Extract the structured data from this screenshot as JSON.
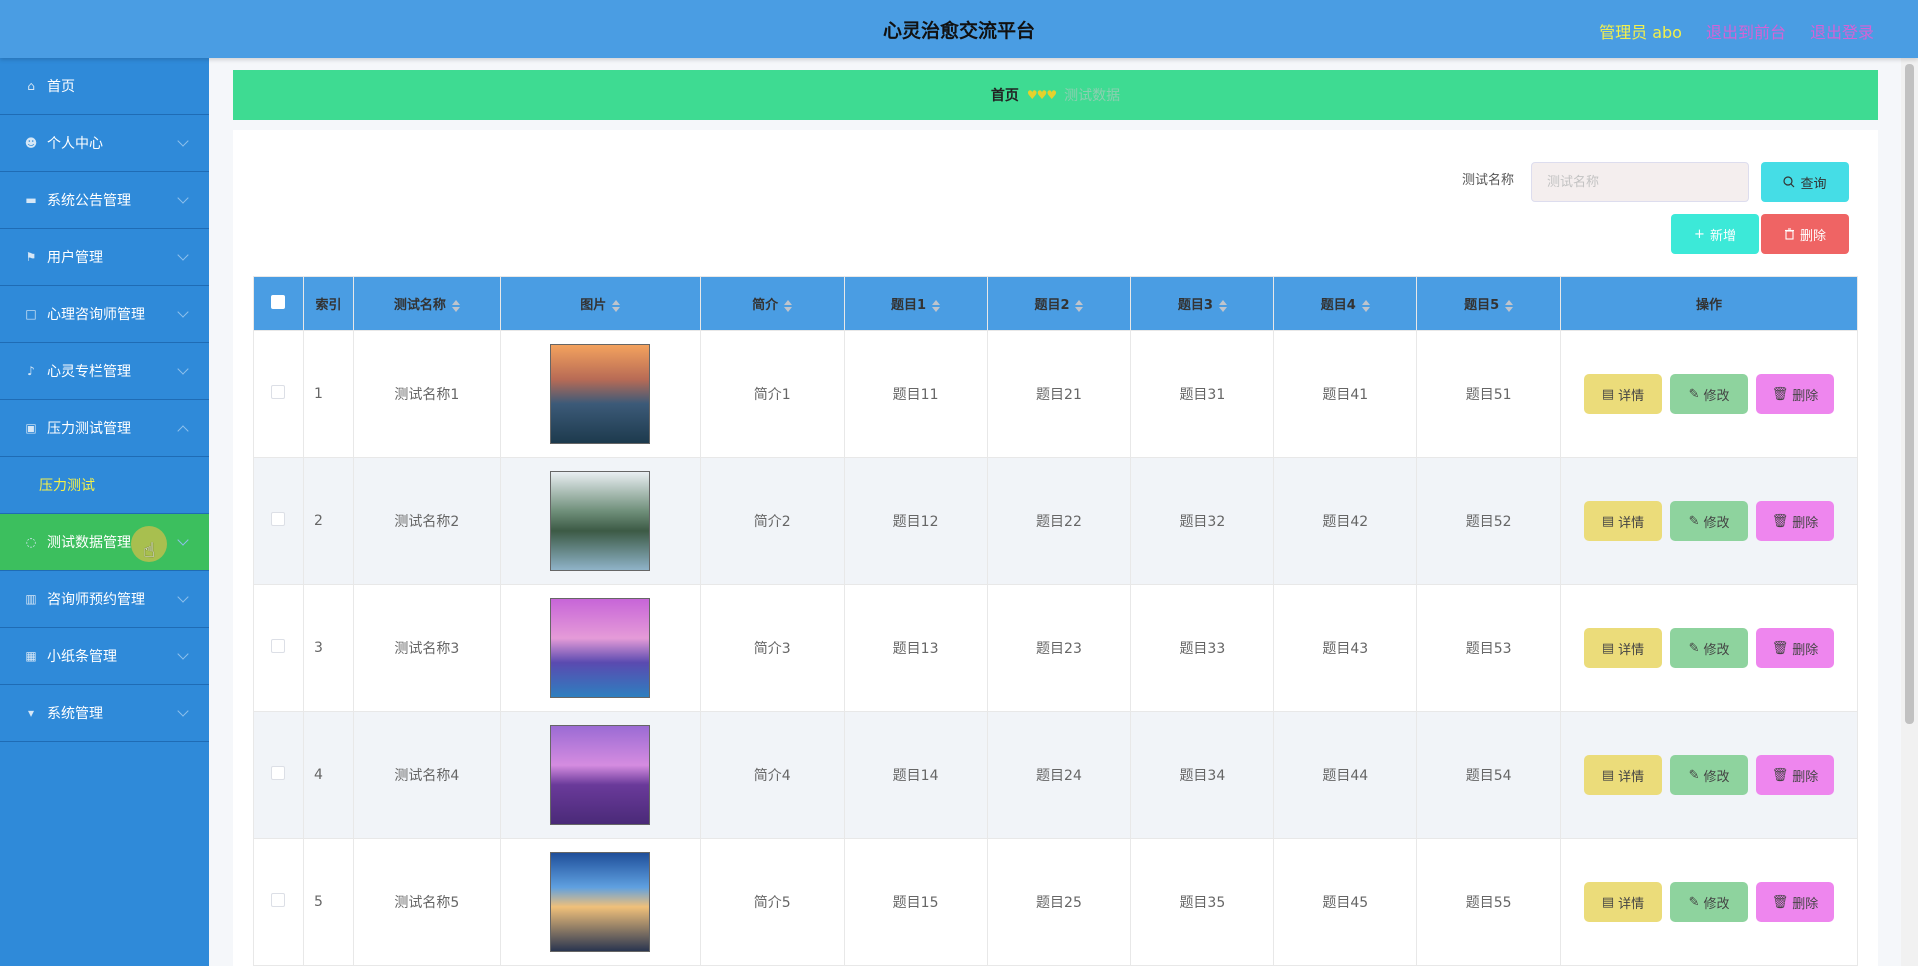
{
  "header": {
    "title": "心灵治愈交流平台",
    "admin_label": "管理员 abo",
    "front_link": "退出到前台",
    "logout_link": "退出登录"
  },
  "sidebar": {
    "items": [
      {
        "label": "首页",
        "icon": "home-icon",
        "glyph": "⌂",
        "expandable": false
      },
      {
        "label": "个人中心",
        "icon": "user-icon",
        "glyph": "☻",
        "expandable": true
      },
      {
        "label": "系统公告管理",
        "icon": "ticket-icon",
        "glyph": "▬",
        "expandable": true
      },
      {
        "label": "用户管理",
        "icon": "flag-icon",
        "glyph": "⚑",
        "expandable": true
      },
      {
        "label": "心理咨询师管理",
        "icon": "square-icon",
        "glyph": "□",
        "expandable": true
      },
      {
        "label": "心灵专栏管理",
        "icon": "microphone-icon",
        "glyph": "♪",
        "expandable": true
      },
      {
        "label": "压力测试管理",
        "icon": "briefcase-icon",
        "glyph": "▣",
        "expandable": true,
        "open": true
      }
    ],
    "sub_item": "压力测试",
    "items_after": [
      {
        "label": "测试数据管理",
        "icon": "loading-icon",
        "glyph": "◌",
        "active": true
      },
      {
        "label": "咨询师预约管理",
        "icon": "bar-chart-icon",
        "glyph": "▥"
      },
      {
        "label": "小纸条管理",
        "icon": "edit-icon",
        "glyph": "▦"
      },
      {
        "label": "系统管理",
        "icon": "trophy-icon",
        "glyph": "▾"
      }
    ]
  },
  "breadcrumb": {
    "home": "首页",
    "separator": "♥♥♥",
    "current": "测试数据"
  },
  "search": {
    "label": "测试名称",
    "placeholder": "测试名称",
    "query_button": "查询"
  },
  "toolbar": {
    "add_button": "新增",
    "delete_button": "删除"
  },
  "table": {
    "columns": [
      "索引",
      "测试名称",
      "图片",
      "简介",
      "题目1",
      "题目2",
      "题目3",
      "题目4",
      "题目5",
      "操作"
    ],
    "rows": [
      {
        "index": "1",
        "name": "测试名称1",
        "intro": "简介1",
        "q1": "题目11",
        "q2": "题目21",
        "q3": "题目31",
        "q4": "题目41",
        "q5": "题目51",
        "thumb": "sunset-harbor"
      },
      {
        "index": "2",
        "name": "测试名称2",
        "intro": "简介2",
        "q1": "题目12",
        "q2": "题目22",
        "q3": "题目32",
        "q4": "题目42",
        "q5": "题目52",
        "thumb": "bridge-mountains"
      },
      {
        "index": "3",
        "name": "测试名称3",
        "intro": "简介3",
        "q1": "题目13",
        "q2": "题目23",
        "q3": "题目33",
        "q4": "题目43",
        "q5": "题目53",
        "thumb": "palm-pool"
      },
      {
        "index": "4",
        "name": "测试名称4",
        "intro": "简介4",
        "q1": "题目14",
        "q2": "题目24",
        "q3": "题目34",
        "q4": "题目44",
        "q5": "题目54",
        "thumb": "purple-sea"
      },
      {
        "index": "5",
        "name": "测试名称5",
        "intro": "简介5",
        "q1": "题目15",
        "q2": "题目25",
        "q3": "题目35",
        "q4": "题目45",
        "q5": "题目55",
        "thumb": "pier-sunset"
      }
    ],
    "actions": {
      "detail": "详情",
      "edit": "修改",
      "delete": "删除"
    }
  },
  "colors": {
    "header": "#4a9de3",
    "sidebar": "#2f8ad9",
    "active_menu": "#3cbf5e",
    "breadcrumb": "#3edb92",
    "detail_button": "#ebdc7a",
    "edit_button": "#8ed39e",
    "delete_button": "#ee86ee"
  }
}
